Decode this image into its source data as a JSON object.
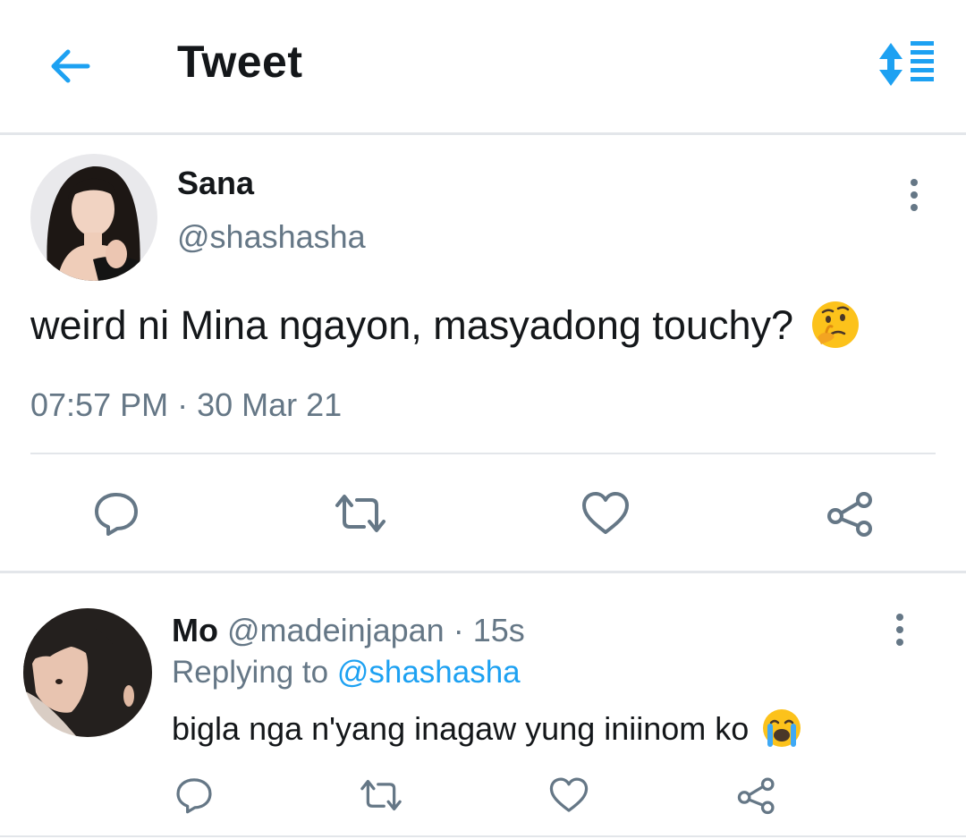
{
  "header": {
    "title": "Tweet"
  },
  "tweet": {
    "name": "Sana",
    "handle": "@shashasha",
    "text": "weird ni Mina ngayon, masyadong touchy?",
    "emoji": "thinking-face",
    "time": "07:57 PM",
    "sep": " · ",
    "date": "30 Mar 21"
  },
  "reply": {
    "name": "Mo",
    "handle": "@madeinjapan",
    "sep": " · ",
    "age": "15s",
    "replying_prefix": "Replying to ",
    "replying_to": "@shashasha",
    "text": "bigla nga n'yang inagaw yung iniinom ko",
    "emoji": "loudly-crying-face"
  },
  "colors": {
    "accent": "#1da1f2",
    "text": "#14171a",
    "muted": "#657786",
    "divider": "#e3e6ea"
  }
}
